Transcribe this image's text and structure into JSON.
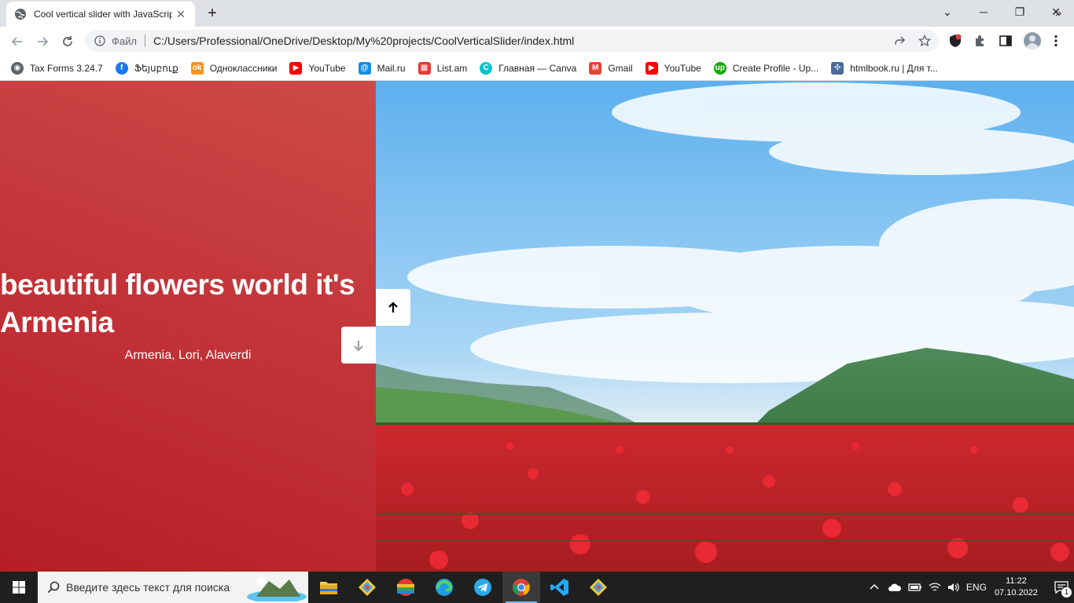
{
  "browser": {
    "tab_title": "Cool vertical slider with JavaScript",
    "tab_close": "✕",
    "new_tab": "+",
    "address_scheme": "Файл",
    "address_url": "C:/Users/Professional/OneDrive/Desktop/My%20projects/CoolVerticalSlider/index.html",
    "window_controls": {
      "minimize": "─",
      "restore": "❐",
      "close": "✕",
      "tab_search": "⌄"
    }
  },
  "bookmarks": [
    {
      "label": "Tax Forms 3.24.7",
      "icon": "globe-icon",
      "color": "#5f6368"
    },
    {
      "label": "Ֆեյսբուք",
      "icon": "facebook-icon",
      "color": "#1877f2"
    },
    {
      "label": "Одноклассники",
      "icon": "odnoklassniki-icon",
      "color": "#f7931e"
    },
    {
      "label": "YouTube",
      "icon": "youtube-icon",
      "color": "#ff0000"
    },
    {
      "label": "Mail.ru",
      "icon": "mailru-icon",
      "color": "#168de2"
    },
    {
      "label": "List.am",
      "icon": "listam-icon",
      "color": "#e53935"
    },
    {
      "label": "Главная — Canva",
      "icon": "canva-icon",
      "color": "#00c4cc"
    },
    {
      "label": "Gmail",
      "icon": "gmail-icon",
      "color": "#ea4335"
    },
    {
      "label": "YouTube",
      "icon": "youtube-icon",
      "color": "#ff0000"
    },
    {
      "label": "Create Profile - Up...",
      "icon": "upwork-icon",
      "color": "#14a800"
    },
    {
      "label": "htmlbook.ru | Для т...",
      "icon": "htmlbook-icon",
      "color": "#4a6a9a"
    }
  ],
  "bookmarks_more": "»",
  "slider": {
    "title": "beautiful flowers world it's Armenia",
    "subtitle": "Armenia, Lori, Alaverdi",
    "left_color": "#c3353a",
    "button_up": "↑",
    "button_down": "↓"
  },
  "taskbar": {
    "search_placeholder": "Введите здесь текст для поиска",
    "language": "ENG",
    "time": "11:22",
    "date": "07.10.2022",
    "notification_count": "1"
  }
}
